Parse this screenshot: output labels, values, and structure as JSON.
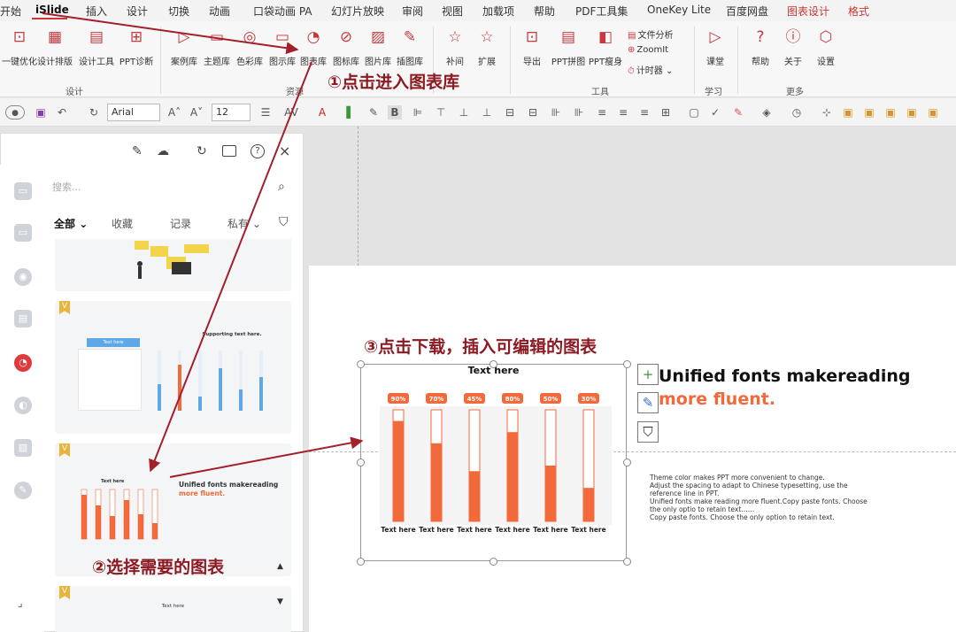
{
  "tabs": [
    "开始",
    "iSlide",
    "插入",
    "设计",
    "切换",
    "动画",
    "口袋动画 PA",
    "幻灯片放映",
    "审阅",
    "视图",
    "加载项",
    "帮助",
    "PDF工具集",
    "OneKey Lite",
    "百度网盘",
    "图表设计",
    "格式"
  ],
  "ribbon": {
    "buttons": [
      {
        "label": "一键优化",
        "icon": "optimize-icon"
      },
      {
        "label": "设计排版",
        "icon": "layout-icon"
      },
      {
        "label": "设计工具",
        "icon": "tools-icon"
      },
      {
        "label": "PPT诊断",
        "icon": "diagnose-icon"
      },
      {
        "label": "案例库",
        "icon": "case-icon"
      },
      {
        "label": "主题库",
        "icon": "theme-icon"
      },
      {
        "label": "色彩库",
        "icon": "palette-icon"
      },
      {
        "label": "图示库",
        "icon": "diagram-icon"
      },
      {
        "label": "图表库",
        "icon": "chart-library-icon"
      },
      {
        "label": "图标库",
        "icon": "icon-library-icon"
      },
      {
        "label": "图片库",
        "icon": "picture-library-icon"
      },
      {
        "label": "插图库",
        "icon": "illustration-icon"
      },
      {
        "label": "补间",
        "icon": "tween-icon"
      },
      {
        "label": "扩展",
        "icon": "extend-icon"
      },
      {
        "label": "导出",
        "icon": "export-icon"
      },
      {
        "label": "PPT拼图",
        "icon": "puzzle-icon"
      },
      {
        "label": "PPT瘦身",
        "icon": "slim-icon"
      },
      {
        "label": "课堂",
        "icon": "class-icon"
      },
      {
        "label": "帮助",
        "icon": "help-icon"
      },
      {
        "label": "关于",
        "icon": "about-icon"
      },
      {
        "label": "设置",
        "icon": "settings-icon"
      }
    ],
    "small": [
      "文件分析",
      "ZoomIt",
      "计时器"
    ],
    "groups": [
      "设计",
      "资源",
      "工具",
      "学习",
      "更多"
    ]
  },
  "format": {
    "font": "Arial",
    "size": "12",
    "bold": "B"
  },
  "panel": {
    "search_placeholder": "搜索...",
    "filters": [
      "全部",
      "收藏",
      "记录",
      "私有"
    ],
    "cards": [
      {
        "title": "Supporting text here.",
        "button": "Text here"
      },
      {
        "title": "Unified fonts makereading",
        "subtitle": "more fluent.",
        "chart_title": "Text here"
      },
      {
        "title": "Text here"
      }
    ],
    "badge": "V"
  },
  "annotations": [
    "①点击进入图表库",
    "②选择需要的图表",
    "③点击下载，插入可编辑的图表"
  ],
  "slide": {
    "chart_title": "Text here",
    "heading": "Unified fonts makereading",
    "subheading": "more fluent.",
    "body": [
      "Theme  color makes PPT more convenient to change.",
      "Adjust the spacing to adapt to Chinese typesetting, use the reference line in PPT.",
      "Unified fonts make reading more fluent.Copy paste fonts. Choose the only optio to retain text……",
      "Copy paste  fonts. Choose the only option to retain text."
    ]
  },
  "chart_data": {
    "type": "bar",
    "title": "Text here",
    "categories": [
      "Text here",
      "Text here",
      "Text here",
      "Text here",
      "Text here",
      "Text here"
    ],
    "values": [
      90,
      70,
      45,
      80,
      50,
      30
    ],
    "labels": [
      "90%",
      "70%",
      "45%",
      "80%",
      "50%",
      "30%"
    ],
    "ylim": [
      0,
      100
    ],
    "color": "#f26a3c"
  },
  "colors": {
    "accent": "#c7373d",
    "orange": "#f26a3c",
    "annotation": "#8b1a22"
  }
}
